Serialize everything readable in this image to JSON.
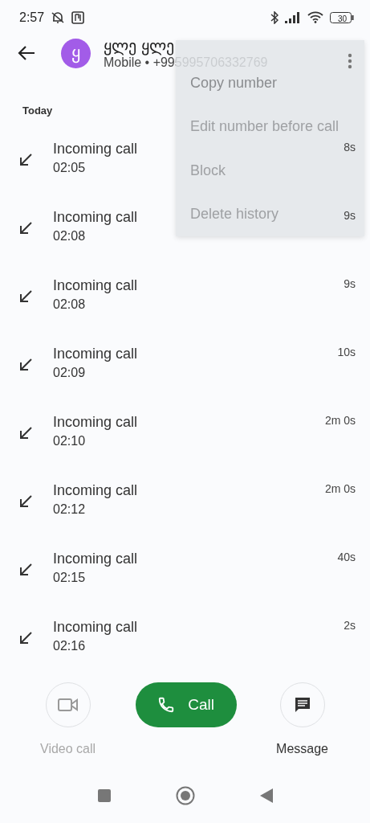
{
  "status_bar": {
    "time": "2:57",
    "battery": "30"
  },
  "contact": {
    "initial": "ყ",
    "name": "ყლე ყლე",
    "subtitle": "Mobile • +995995706332769"
  },
  "menu": {
    "open": true,
    "items": [
      {
        "label": "Copy number"
      },
      {
        "label": "Edit number before call"
      },
      {
        "label": "Block"
      },
      {
        "label": "Delete history"
      }
    ]
  },
  "section": "Today",
  "calls": [
    {
      "type": "Incoming call",
      "time": "02:05",
      "duration": "8s"
    },
    {
      "type": "Incoming call",
      "time": "02:08",
      "duration": "9s"
    },
    {
      "type": "Incoming call",
      "time": "02:08",
      "duration": "9s"
    },
    {
      "type": "Incoming call",
      "time": "02:09",
      "duration": "10s"
    },
    {
      "type": "Incoming call",
      "time": "02:10",
      "duration": "2m 0s"
    },
    {
      "type": "Incoming call",
      "time": "02:12",
      "duration": "2m 0s"
    },
    {
      "type": "Incoming call",
      "time": "02:15",
      "duration": "40s"
    },
    {
      "type": "Incoming call",
      "time": "02:16",
      "duration": "2s"
    }
  ],
  "actions": [
    {
      "kind": "video",
      "label": "Video call",
      "disabled": true
    },
    {
      "kind": "call",
      "label": "Call"
    },
    {
      "kind": "message",
      "label": "Message",
      "disabled": false
    }
  ]
}
